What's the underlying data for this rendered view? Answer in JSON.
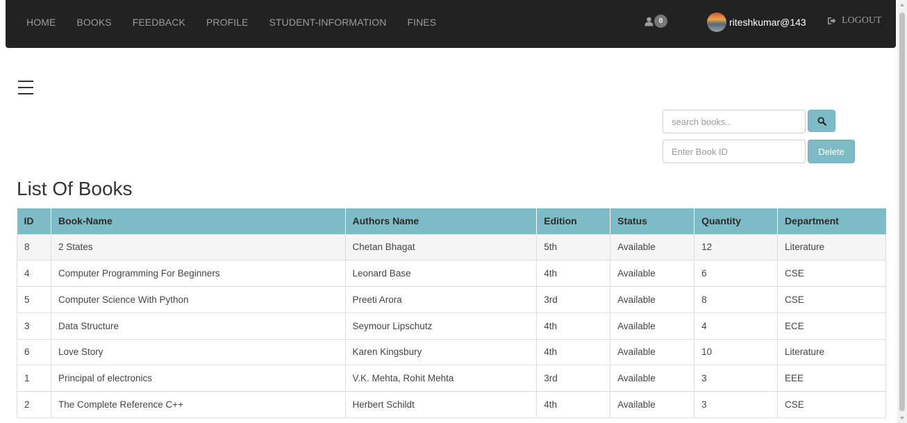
{
  "nav": {
    "links": [
      "HOME",
      "BOOKS",
      "FEEDBACK",
      "PROFILE",
      "STUDENT-INFORMATION",
      "FINES"
    ],
    "notification_count": "0",
    "username": "riteshkumar@143",
    "logout_label": "LOGOUT"
  },
  "search": {
    "placeholder": "search books..",
    "bookid_placeholder": "Enter Book ID",
    "delete_label": "Delete"
  },
  "page_title": "List Of Books",
  "table": {
    "headers": [
      "ID",
      "Book-Name",
      "Authors Name",
      "Edition",
      "Status",
      "Quantity",
      "Department"
    ],
    "rows": [
      [
        "8",
        "2 States",
        "Chetan Bhagat",
        "5th",
        "Available",
        "12",
        "Literature"
      ],
      [
        "4",
        "Computer Programming For Beginners",
        "Leonard Base",
        "4th",
        "Available",
        "6",
        "CSE"
      ],
      [
        "5",
        "Computer Science With Python",
        "Preeti Arora",
        "3rd",
        "Available",
        "8",
        "CSE"
      ],
      [
        "3",
        "Data Structure",
        "Seymour Lipschutz",
        "4th",
        "Available",
        "4",
        "ECE"
      ],
      [
        "6",
        "Love Story",
        "Karen Kingsbury",
        "4th",
        "Available",
        "10",
        "Literature"
      ],
      [
        "1",
        "Principal of electronics",
        "V.K. Mehta, Rohit Mehta",
        "3rd",
        "Available",
        "3",
        "EEE"
      ],
      [
        "2",
        "The Complete Reference C++",
        "Herbert Schildt",
        "4th",
        "Available",
        "3",
        "CSE"
      ]
    ]
  },
  "icons": {
    "user": "user-icon",
    "logout": "logout-icon",
    "search": "search-icon",
    "menu": "hamburger-menu-icon"
  },
  "colors": {
    "navbar": "#222222",
    "accent": "#7dbcc6"
  }
}
